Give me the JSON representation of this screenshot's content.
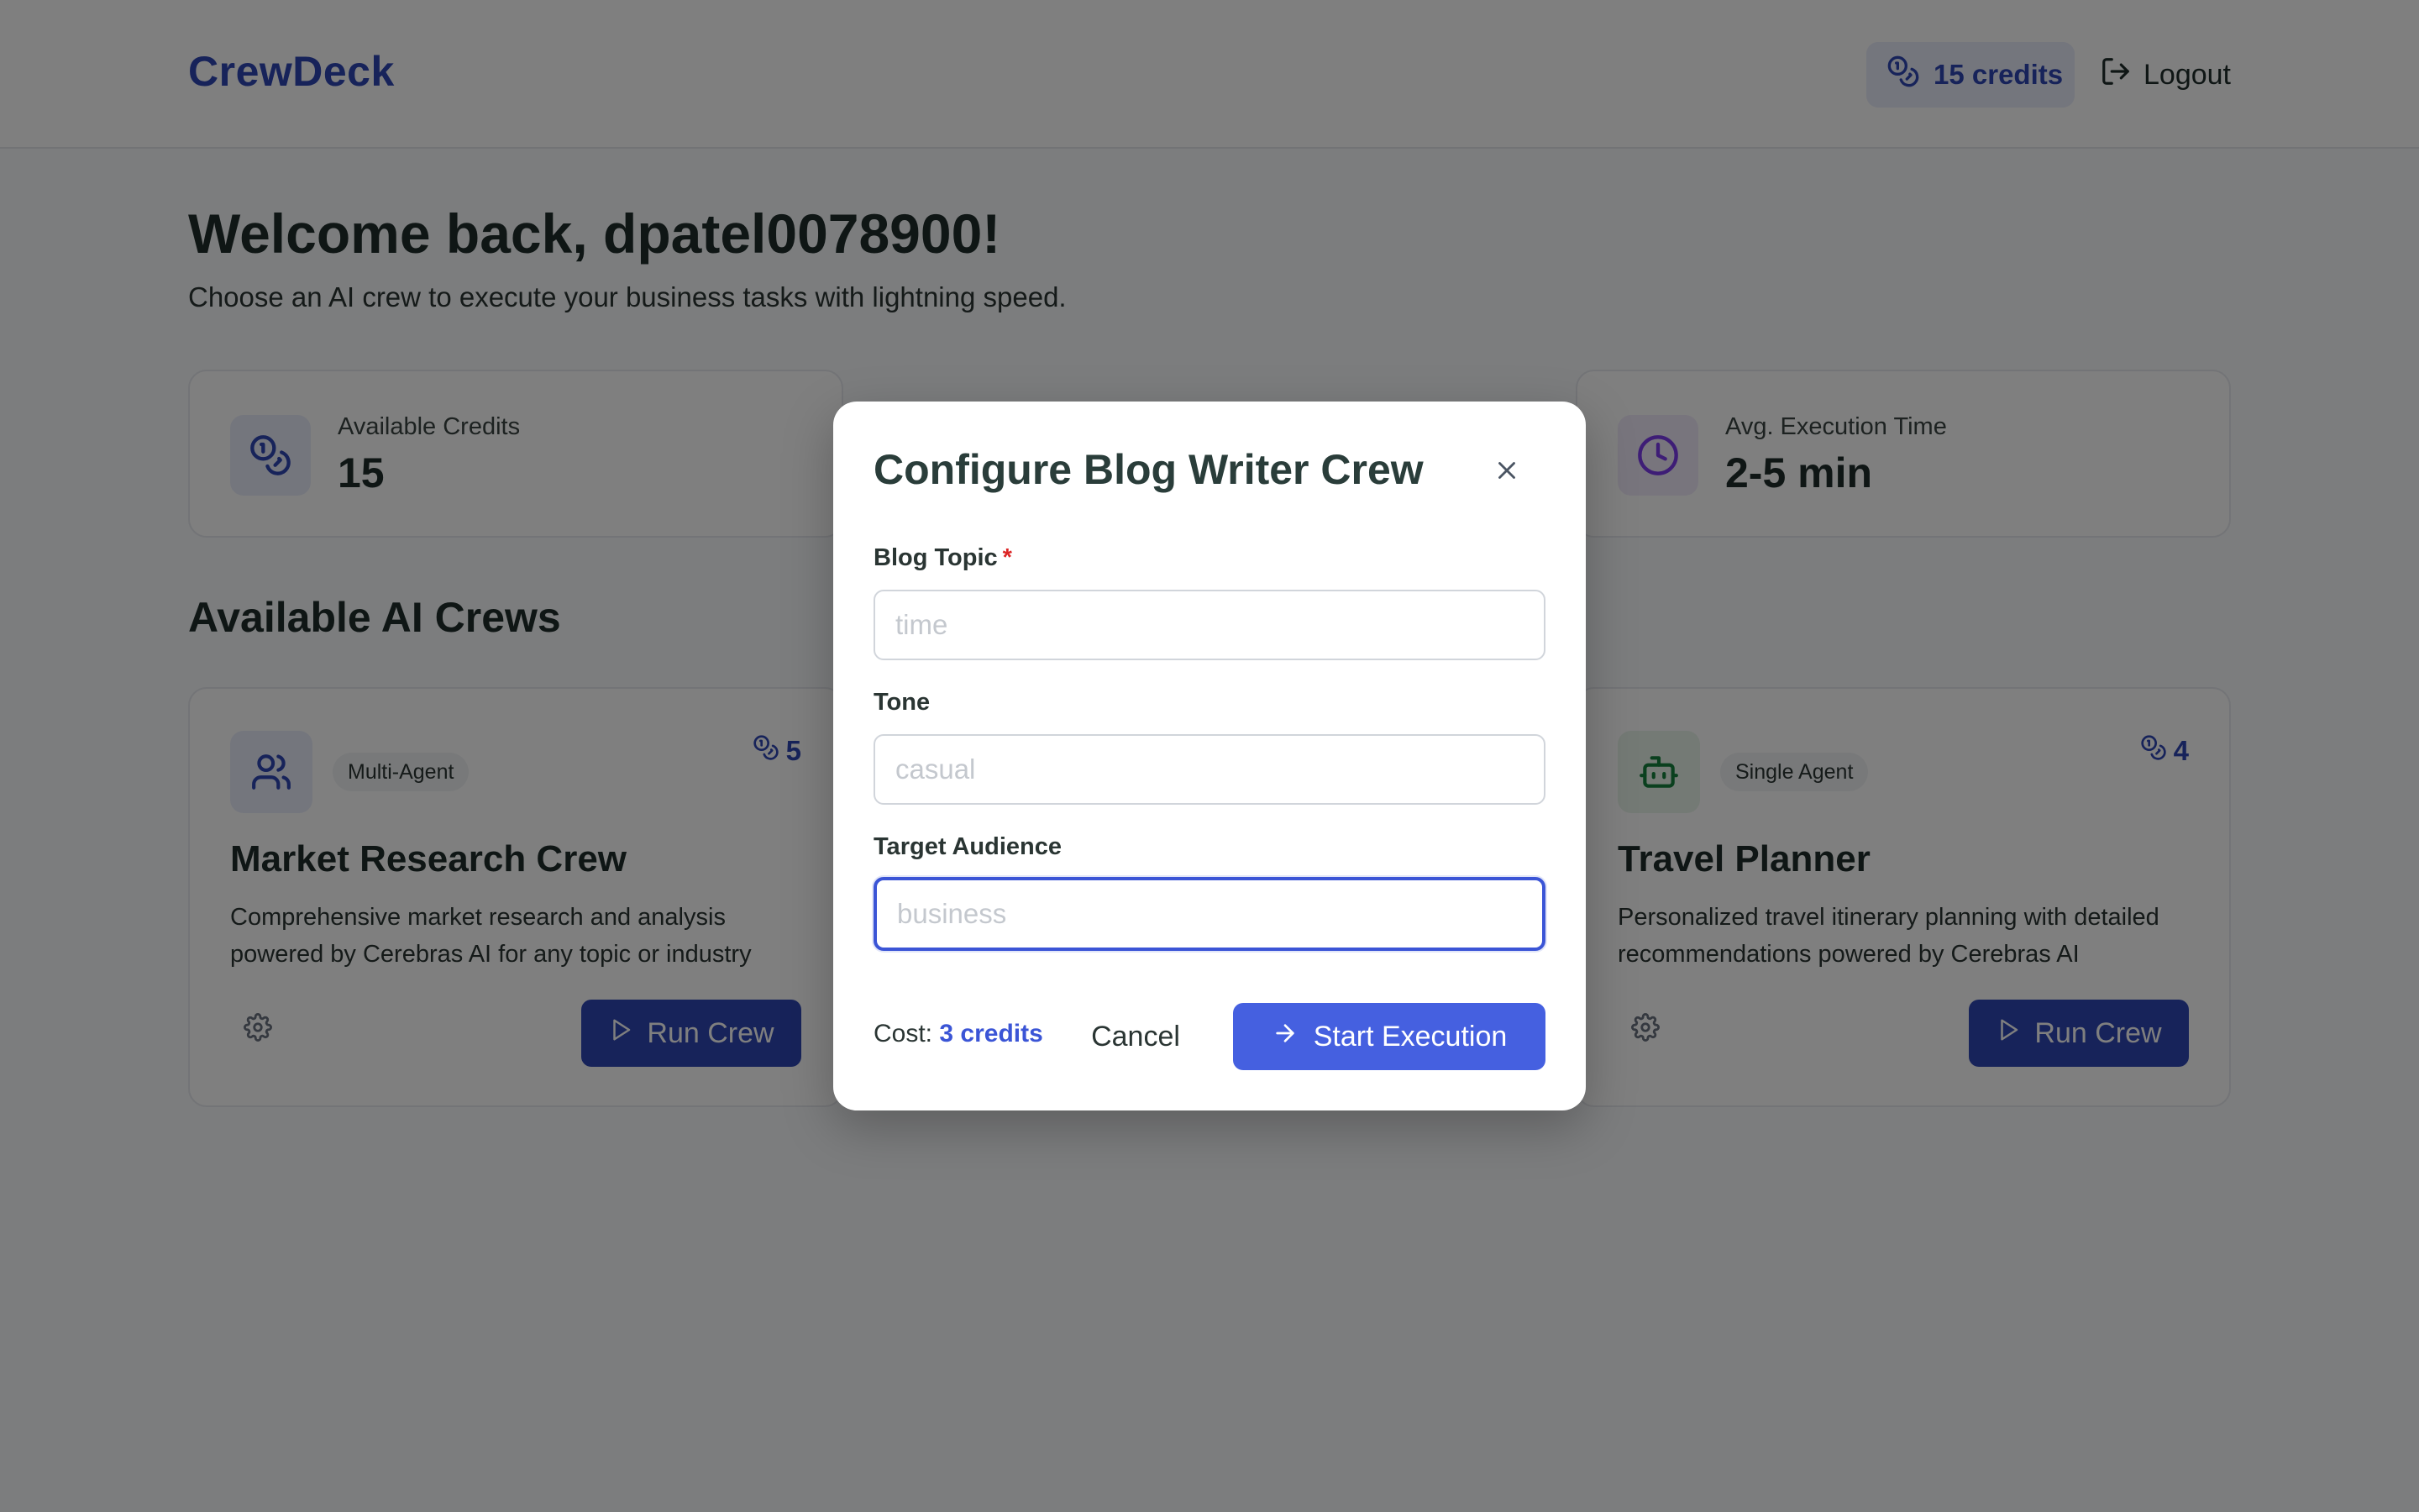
{
  "header": {
    "brand": "CrewDeck",
    "credits_label": "15 credits",
    "logout_label": "Logout"
  },
  "main": {
    "welcome": "Welcome back, dpatel0078900!",
    "subtitle": "Choose an AI crew to execute your business tasks with lightning speed.",
    "stats": [
      {
        "label": "Available Credits",
        "value": "15",
        "icon": "coins-icon"
      },
      {
        "label": "Avg. Execution Time",
        "value": "2-5 min",
        "icon": "clock-icon"
      }
    ],
    "section_title": "Available AI Crews",
    "crews": [
      {
        "badge": "Multi-Agent",
        "cost": "5",
        "name": "Market Research Crew",
        "description": "Comprehensive market research and analysis powered by Cerebras AI for any topic or industry",
        "run_label": "Run Crew",
        "icon": "users-icon"
      },
      {
        "badge": "Single Agent",
        "cost": "4",
        "name": "Travel Planner",
        "description": "Personalized travel itinerary planning with detailed recommendations powered by Cerebras AI",
        "run_label": "Run Crew",
        "icon": "robot-icon"
      }
    ]
  },
  "modal": {
    "title": "Configure Blog Writer Crew",
    "fields": [
      {
        "label": "Blog Topic",
        "required_mark": "*",
        "placeholder": "time",
        "value": ""
      },
      {
        "label": "Tone",
        "placeholder": "casual",
        "value": ""
      },
      {
        "label": "Target Audience",
        "placeholder": "business",
        "value": ""
      }
    ],
    "cost_label": "Cost:",
    "cost_value": "3 credits",
    "cancel_label": "Cancel",
    "start_label": "Start Execution"
  },
  "colors": {
    "brand": "#2f46b4",
    "accent": "#4560e0",
    "required": "#dc2626",
    "overlay": "rgba(0,0,0,0.5)"
  }
}
